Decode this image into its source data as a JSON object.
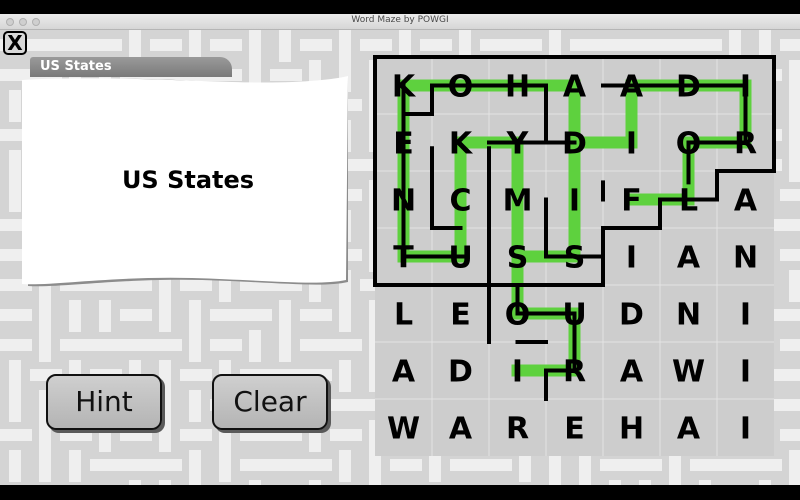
{
  "window": {
    "title": "Word Maze by POWGI",
    "close_label": "X"
  },
  "category": {
    "tab_label": "US States",
    "title": "US States"
  },
  "buttons": {
    "hint": "Hint",
    "clear": "Clear"
  },
  "grid": {
    "rows": 7,
    "cols": 7,
    "letters": [
      [
        "K",
        "O",
        "H",
        "A",
        "A",
        "D",
        "I"
      ],
      [
        "E",
        "K",
        "Y",
        "D",
        "I",
        "O",
        "R"
      ],
      [
        "N",
        "C",
        "M",
        "I",
        "F",
        "L",
        "A"
      ],
      [
        "T",
        "U",
        "S",
        "S",
        "I",
        "A",
        "N"
      ],
      [
        "L",
        "E",
        "O",
        "U",
        "D",
        "N",
        "I"
      ],
      [
        "A",
        "D",
        "I",
        "R",
        "A",
        "W",
        "I"
      ],
      [
        "W",
        "A",
        "R",
        "E",
        "H",
        "A",
        "I"
      ]
    ],
    "highlight_color": "#5ed13e",
    "board_color": "#cdcdcd",
    "wall_color": "#000000",
    "paths": [
      [
        [
          0,
          0
        ],
        [
          0,
          1
        ],
        [
          0,
          2
        ],
        [
          0,
          3
        ],
        [
          1,
          3
        ],
        [
          1,
          4
        ],
        [
          0,
          4
        ],
        [
          0,
          5
        ],
        [
          0,
          6
        ],
        [
          1,
          6
        ],
        [
          1,
          5
        ],
        [
          2,
          5
        ],
        [
          2,
          4
        ]
      ],
      [
        [
          1,
          1
        ],
        [
          1,
          2
        ],
        [
          2,
          2
        ],
        [
          3,
          2
        ],
        [
          3,
          3
        ],
        [
          2,
          3
        ],
        [
          1,
          3
        ]
      ],
      [
        [
          0,
          0
        ],
        [
          1,
          0
        ],
        [
          2,
          0
        ],
        [
          3,
          0
        ],
        [
          3,
          1
        ],
        [
          2,
          1
        ],
        [
          1,
          1
        ]
      ],
      [
        [
          3,
          2
        ],
        [
          4,
          2
        ],
        [
          4,
          3
        ],
        [
          5,
          3
        ],
        [
          5,
          2
        ]
      ]
    ]
  }
}
